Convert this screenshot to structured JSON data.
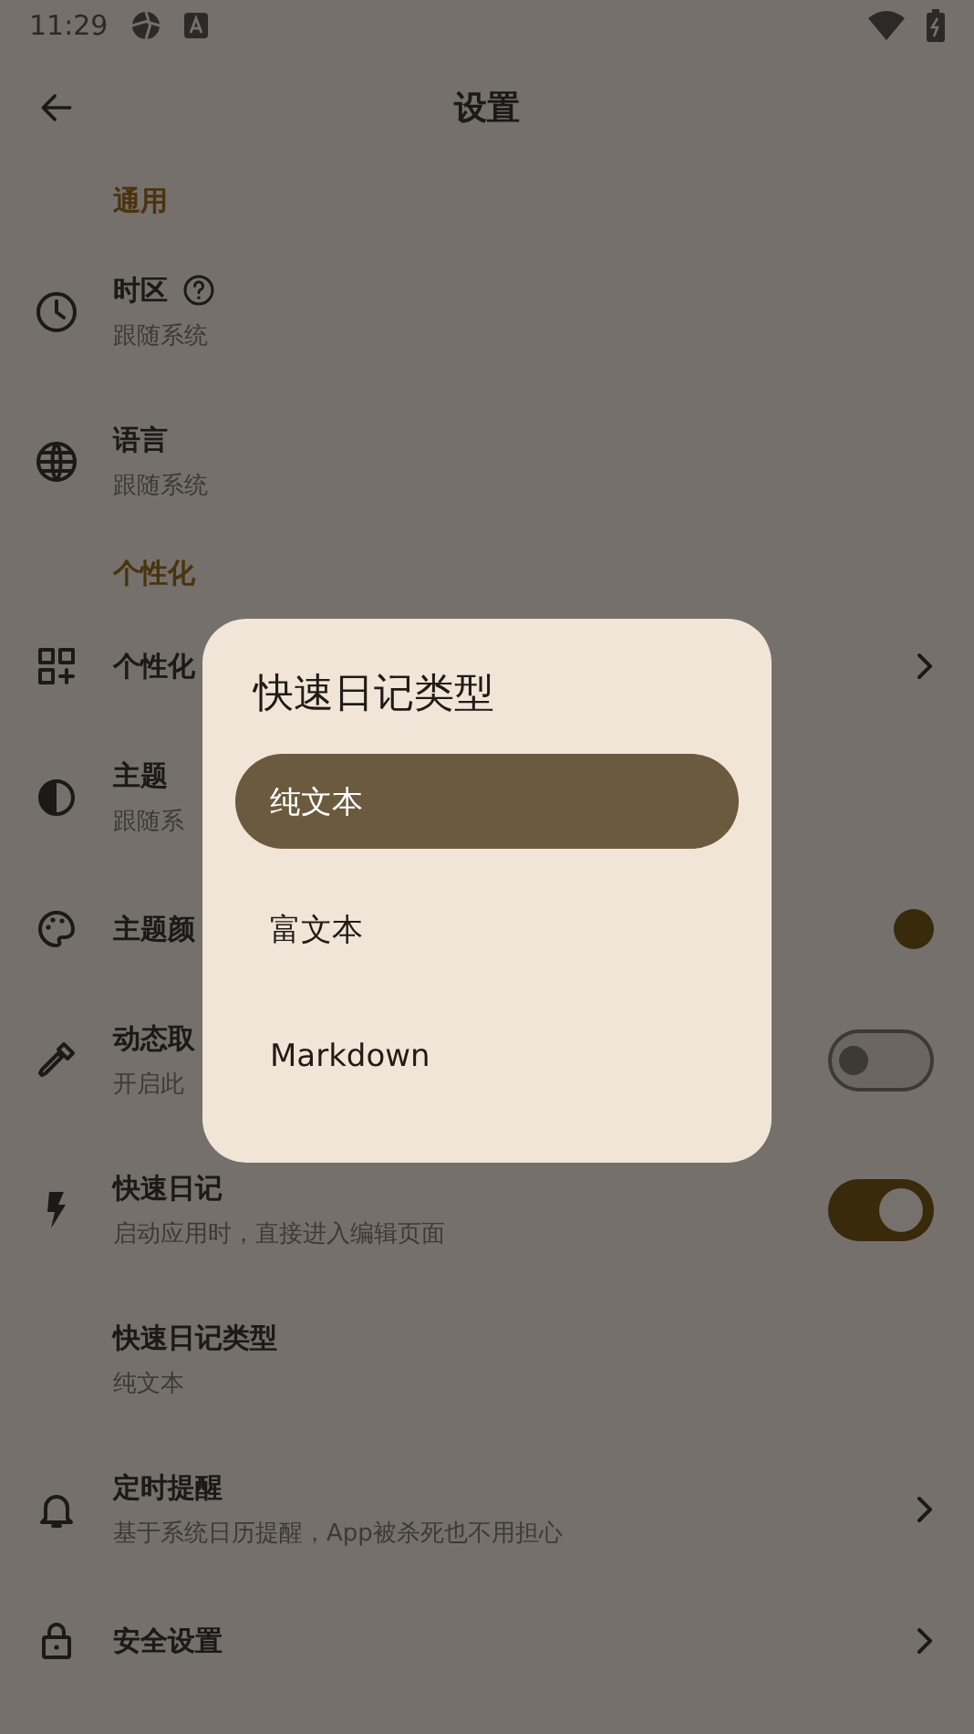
{
  "status_bar": {
    "time": "11:29"
  },
  "app_bar": {
    "title": "设置"
  },
  "sections": [
    {
      "header": "通用",
      "items": [
        {
          "title": "时区",
          "subtitle": "跟随系统",
          "help": true,
          "kind": "plain"
        },
        {
          "title": "语言",
          "subtitle": "跟随系统",
          "help": false,
          "kind": "plain"
        }
      ]
    },
    {
      "header": "个性化",
      "items": [
        {
          "title": "个性化",
          "help": false,
          "kind": "nav"
        },
        {
          "title": "主题",
          "subtitle": "跟随系",
          "help": false,
          "kind": "plain"
        },
        {
          "title": "主题颜",
          "help": false,
          "kind": "color",
          "color": "#3a2a0c"
        },
        {
          "title": "动态取",
          "subtitle": "开启此",
          "help": false,
          "kind": "switch",
          "on": false
        },
        {
          "title": "快速日记",
          "subtitle": "启动应用时，直接进入编辑页面",
          "help": false,
          "kind": "switch",
          "on": true
        },
        {
          "title": "快速日记类型",
          "subtitle": "纯文本",
          "help": false,
          "kind": "plain"
        },
        {
          "title": "定时提醒",
          "subtitle": "基于系统日历提醒，App被杀死也不用担心",
          "help": false,
          "kind": "nav"
        },
        {
          "title": "安全设置",
          "help": false,
          "kind": "nav"
        }
      ]
    }
  ],
  "dialog": {
    "title": "快速日记类型",
    "options": [
      {
        "label": "纯文本",
        "selected": true
      },
      {
        "label": "富文本",
        "selected": false
      },
      {
        "label": "Markdown",
        "selected": false
      }
    ]
  }
}
